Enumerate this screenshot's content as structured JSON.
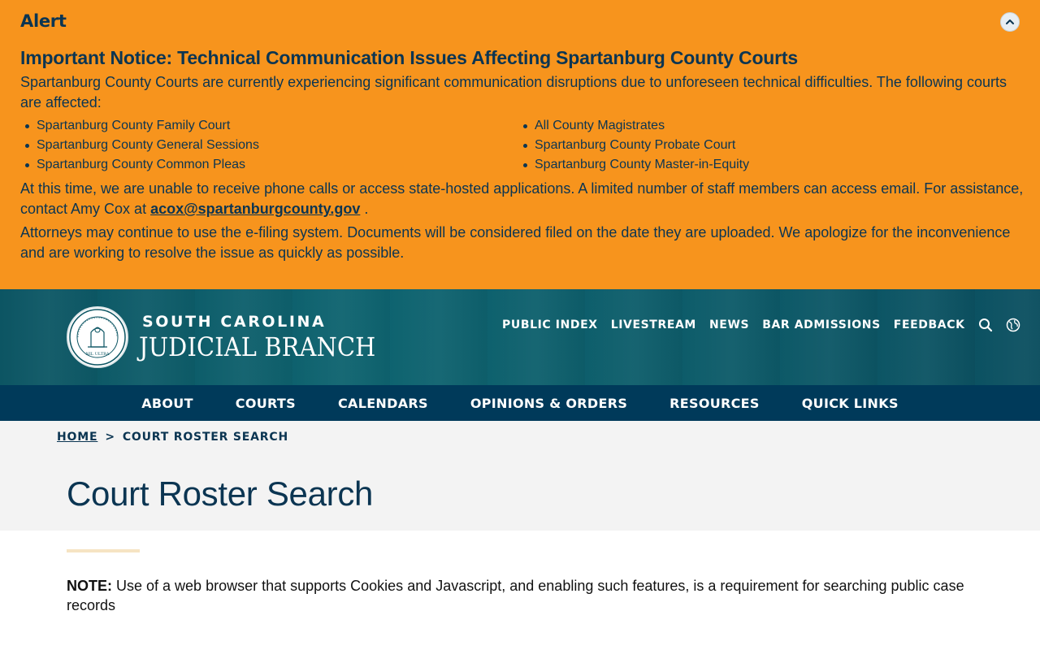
{
  "alert": {
    "heading": "Alert",
    "title": "Important Notice: Technical Communication Issues Affecting Spartanburg County Courts",
    "intro": "Spartanburg County Courts are currently experiencing significant communication disruptions due to unforeseen technical difficulties. The following courts are affected:",
    "courts": [
      "Spartanburg County Family Court",
      "All County Magistrates",
      "Spartanburg County General Sessions",
      "Spartanburg County Probate Court",
      "Spartanburg County Common Pleas",
      "Spartanburg County Master-in-Equity"
    ],
    "p2_text": "At this time, we are unable to receive phone calls or access state-hosted applications. A limited number of staff members can access email. For assistance, contact Amy Cox at",
    "p2_email": "acox@spartanburgcounty.gov",
    "p2_end": ".",
    "p3": "Attorneys may continue to use the e-filing system. Documents will be considered filed on the date they are uploaded. We apologize for the inconvenience and are working to resolve the issue as quickly as possible.",
    "toggle_icon": "chevron-up-icon"
  },
  "brand": {
    "top": "SOUTH CAROLINA",
    "main": "JUDICIAL BRANCH",
    "seal_motto": "NIL ULTRA"
  },
  "util_nav": [
    "PUBLIC INDEX",
    "LIVESTREAM",
    "NEWS",
    "BAR ADMISSIONS",
    "FEEDBACK"
  ],
  "main_nav": [
    "ABOUT",
    "COURTS",
    "CALENDARS",
    "OPINIONS & ORDERS",
    "RESOURCES",
    "QUICK LINKS"
  ],
  "breadcrumb": {
    "home": "HOME",
    "separator": ">",
    "current": "COURT ROSTER SEARCH"
  },
  "page": {
    "title": "Court Roster Search",
    "note_label": "NOTE:",
    "note_text": "Use of a web browser that supports Cookies and Javascript, and enabling such features, is a requirement for searching public case records"
  },
  "colors": {
    "alert_bg": "#f7941d",
    "navy": "#0b3552",
    "header_teal": "#0e6470",
    "nav_bg": "#003a5a"
  }
}
